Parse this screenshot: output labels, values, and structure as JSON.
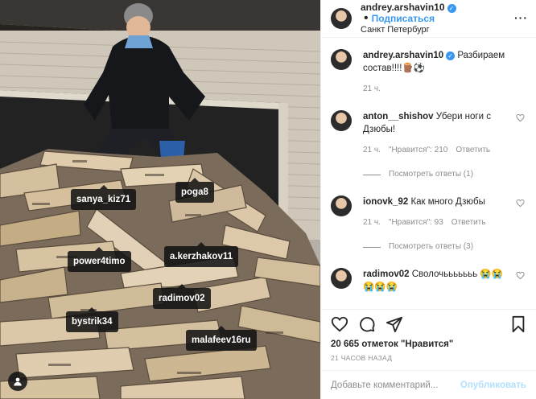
{
  "post": {
    "author": "andrey.arshavin10",
    "follow_label": "Подписаться",
    "location": "Санкт Петербург",
    "separator": "•",
    "more_label": "···"
  },
  "photo": {
    "tags": [
      "sanya_kiz71",
      "poga8",
      "power4timo",
      "a.kerzhakov11",
      "radimov02",
      "bystrik34",
      "malafeev16ru"
    ]
  },
  "caption": {
    "username": "andrey.arshavin10",
    "text": "Разбираем состав!!!!🪵⚽",
    "time": "21 ч."
  },
  "comments": [
    {
      "username": "anton__shishov",
      "text": "Убери ноги с Дзюбы!",
      "time": "21 ч.",
      "likes": "\"Нравится\": 210",
      "reply": "Ответить",
      "view_replies": "Посмотреть ответы (1)"
    },
    {
      "username": "ionovk_92",
      "text": "Как много Дзюбы",
      "time": "21 ч.",
      "likes": "\"Нравится\": 93",
      "reply": "Ответить",
      "view_replies": "Посмотреть ответы (3)"
    },
    {
      "username": "radimov02",
      "text": "Сволочььььььь 😭😭😭😭😭"
    }
  ],
  "likes_text": "20 665 отметок \"Нравится\"",
  "date_text": "21 ЧАСОВ НАЗАД",
  "comment_input": {
    "placeholder": "Добавьте комментарий...",
    "post_label": "Опубликовать"
  },
  "icons": {
    "verified": "verified-badge-icon",
    "heart": "heart-icon",
    "comment": "comment-icon",
    "share": "share-icon",
    "bookmark": "bookmark-icon",
    "user_tag": "user-tag-icon"
  },
  "colors": {
    "accent": "#3897f0",
    "muted": "#8e8e8e",
    "text": "#262626",
    "post_disabled": "#b2dffc"
  }
}
